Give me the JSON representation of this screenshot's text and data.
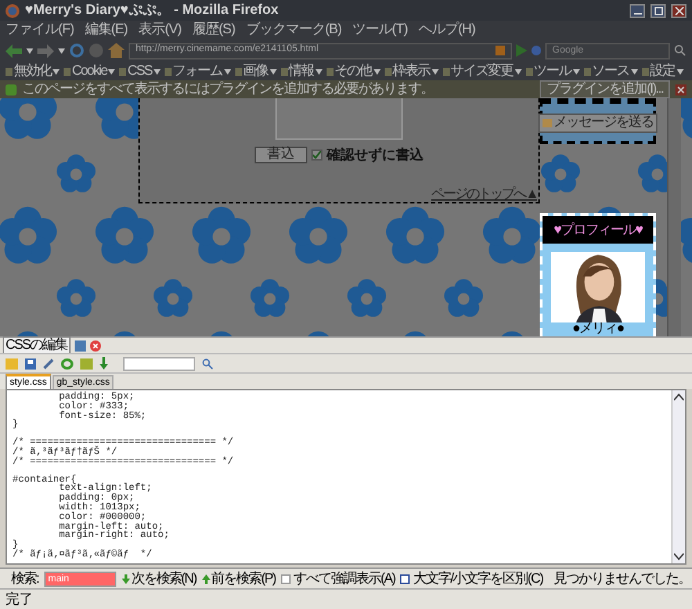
{
  "window": {
    "title": "♥Merry's Diary♥ぷぷ。 - Mozilla Firefox"
  },
  "menu": [
    "ファイル(F)",
    "編集(E)",
    "表示(V)",
    "履歴(S)",
    "ブックマーク(B)",
    "ツール(T)",
    "ヘルプ(H)"
  ],
  "address_bar": {
    "value": "http://merry.cinemame.com/e2141105.html"
  },
  "search_box": {
    "placeholder": "Google"
  },
  "devtools_toolbar": [
    "無効化",
    "Cookie",
    "CSS",
    "フォーム",
    "画像",
    "情報",
    "その他",
    "枠表示",
    "サイズ変更",
    "ツール",
    "ソース",
    "設定"
  ],
  "notification": {
    "message": "このページをすべて表示するにはプラグインを追加する必要があります。",
    "button": "プラグインを追加(I)..."
  },
  "page": {
    "submit_button": "書込",
    "no_confirm": {
      "label": "確認せずに書込",
      "checked": true
    },
    "top_link": "ページのトップへ▲",
    "message_button": "メッセージを送る",
    "profile": {
      "title": "♥プロフィール♥",
      "name": "●メリィ●"
    }
  },
  "css_editor": {
    "title": "CSSの編集",
    "tabs": [
      {
        "label": "style.css",
        "selected": true
      },
      {
        "label": "gb_style.css",
        "selected": false
      }
    ],
    "code_blocks": [
      [
        "\tpadding: 5px;",
        "\tcolor: #333;",
        "\tfont-size: 85%;",
        "}"
      ],
      [
        "/* ================================ */",
        "/* ã‚³ãƒ³ãƒ†ãƒŠ */",
        "/* ================================ */"
      ],
      [
        "#container{",
        "\ttext-align:left;",
        "\tpadding: 0px;",
        "\twidth: 1013px;",
        "\tcolor: #000000;",
        "\tmargin-left: auto;",
        "\tmargin-right: auto;",
        "}",
        "/* ãƒ¡ã‚¤ãƒ³ã‚«ãƒ©ãƒ  */"
      ]
    ]
  },
  "find_bar": {
    "label": "検索:",
    "value": "main",
    "not_found": true,
    "next": "次を検索(N)",
    "previous": "前を検索(P)",
    "options": [
      {
        "label": "すべて強調表示(A)",
        "checked": false
      },
      {
        "label": "大文字/小文字を区別(C)",
        "checked": false
      }
    ],
    "message": "見つかりませんでした。"
  },
  "status_bar": {
    "text": "完了"
  }
}
